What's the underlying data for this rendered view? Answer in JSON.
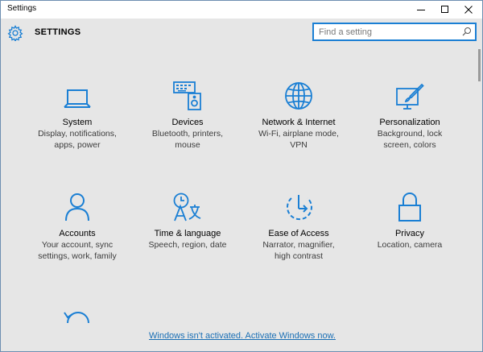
{
  "window": {
    "title": "Settings"
  },
  "header": {
    "title": "SETTINGS",
    "search_placeholder": "Find a setting"
  },
  "tiles": [
    {
      "name": "System",
      "desc": "Display, notifications,\napps, power",
      "icon": "laptop-icon"
    },
    {
      "name": "Devices",
      "desc": "Bluetooth, printers,\nmouse",
      "icon": "devices-icon"
    },
    {
      "name": "Network & Internet",
      "desc": "Wi-Fi, airplane mode,\nVPN",
      "icon": "globe-icon"
    },
    {
      "name": "Personalization",
      "desc": "Background, lock\nscreen, colors",
      "icon": "personalization-icon"
    },
    {
      "name": "Accounts",
      "desc": "Your account, sync\nsettings, work, family",
      "icon": "person-icon"
    },
    {
      "name": "Time & language",
      "desc": "Speech, region, date",
      "icon": "time-language-icon"
    },
    {
      "name": "Ease of Access",
      "desc": "Narrator, magnifier,\nhigh contrast",
      "icon": "ease-of-access-icon"
    },
    {
      "name": "Privacy",
      "desc": "Location, camera",
      "icon": "lock-icon"
    }
  ],
  "partial_tile": {
    "icon": "update-security-icon"
  },
  "activation_link": "Windows isn't activated. Activate Windows now.",
  "colors": {
    "accent": "#1a7fd4",
    "background": "#e6e6e6"
  }
}
